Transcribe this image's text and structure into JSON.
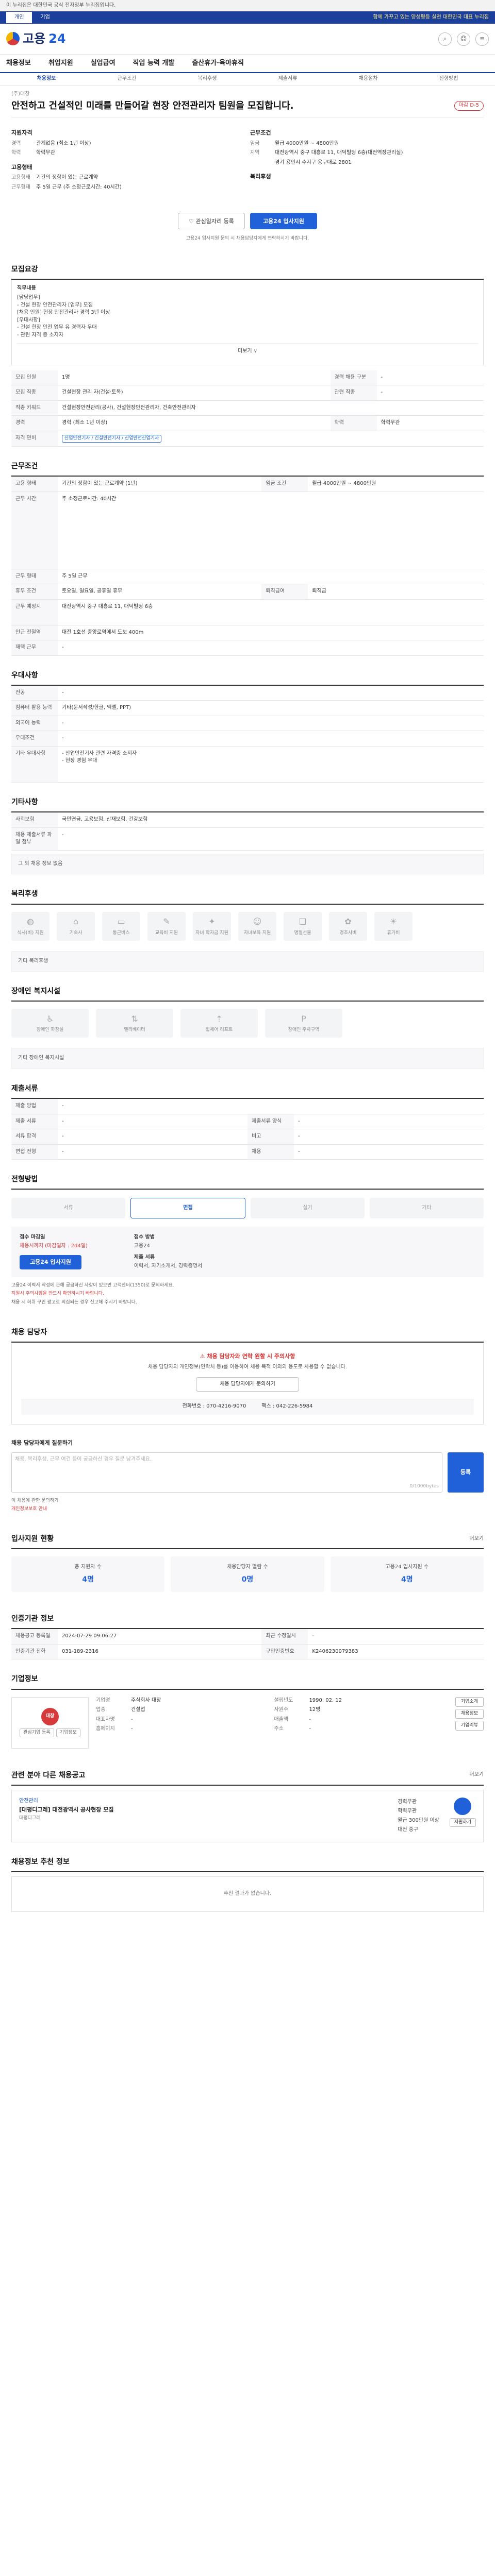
{
  "gov_strip": "이 누리집은 대한민국 공식 전자정부 누리집입니다.",
  "topbar": {
    "tabs": [
      "개인",
      "기업"
    ],
    "right_text": "함께 가꾸고 있는 양성평등 실천 대한민국 대표 누리집"
  },
  "logo": {
    "name": "고용",
    "num": "24"
  },
  "gnb": [
    "채용정보",
    "취업지원",
    "실업급여",
    "직업 능력 개발",
    "출산휴가·육아휴직"
  ],
  "subnav": [
    "채용정보",
    "근무조건",
    "복리후생",
    "제출서류",
    "채용절차",
    "전형방법"
  ],
  "job": {
    "company": "(주)대창",
    "title": "안전하고 건설적인 미래를 만들어갈 현장 안전관리자 팀원을 모집합니다.",
    "badge": "마감 D-5",
    "left_head": "지원자격",
    "left": [
      {
        "k": "경력",
        "v": "관계없음 (최소 1년 이상)"
      },
      {
        "k": "학력",
        "v": "학력무관"
      }
    ],
    "right_head": "근무조건",
    "right": [
      {
        "k": "임금",
        "v": "월급 4000만원 ~ 4800만원"
      },
      {
        "k": "지역",
        "v": "대전광역시 중구 대흥로 11, 대덕빌딩 6층(대전역장관리실)"
      },
      {
        "k": "",
        "v": "경기 용인시 수지구 용구대로 2801"
      }
    ],
    "left_head2": "고용형태",
    "left2": [
      {
        "k": "고용형태",
        "v": "기간의 정함이 있는 근로계약"
      },
      {
        "k": "근무형태",
        "v": "주 5일 근무 (주 소정근로시간: 40시간)"
      }
    ],
    "right_head2": "복리후생",
    "right2": []
  },
  "buttons": {
    "scrap": "관심일자리 등록",
    "apply": "고용24 입사지원"
  },
  "notice": "고용24 입사지원 문의 시 채용담당자에게 연락하시기 바랍니다.",
  "recruit": {
    "title": "모집요강",
    "desc_head": "직무내용",
    "desc": [
      "[담당업무]",
      "- 건설 현장 안전관리자 [업무] 모집",
      "[채용 인원] 현장 안전관리자 경력 3년 이상",
      "[우대사항]",
      "- 건설 현장 안전 업무 유 경력자 우대",
      "- 관련 자격 증 소지자"
    ],
    "expand": "더보기 ∨",
    "rows": [
      {
        "k": "모집 인원",
        "v": "1명",
        "k2": "경력 채용 구분",
        "v2": "-"
      },
      {
        "k": "모집 직종",
        "v": "건설현장 관리 자(건설·토목)",
        "k2": "관련 직종",
        "v2": "-"
      },
      {
        "k": "직종 키워드",
        "v": "건설현장안전관리(공사), 건설현장안전관리자, 건축안전관리자",
        "k2": "",
        "v2": ""
      },
      {
        "k": "경력",
        "v": "경력 (최소 1년 이상)",
        "k2": "학력",
        "v2": "학력무관"
      },
      {
        "k": "자격 면허",
        "v": "산업안전기사 / 건설안전기사 / 산업안전산업기사",
        "k2": "",
        "v2": ""
      }
    ]
  },
  "conditions": {
    "title": "근무조건",
    "rows": [
      {
        "k": "고용 형태",
        "v": "기간의 정함이 있는 근로계약 (1년)",
        "k2": "임금 조건",
        "v2": "월급 4000만원 ~ 4800만원"
      },
      {
        "k": "근무 시간",
        "v": "주 소정근로시간: 40시간",
        "k2": "",
        "v2": ""
      },
      {
        "k": "근무 형태",
        "v": "주 5일 근무",
        "k2": "",
        "v2": ""
      },
      {
        "k": "휴무 조건",
        "v": "토요일, 일요일, 공휴일 휴무",
        "k2": "퇴직급여",
        "v2": "퇴직금"
      },
      {
        "k": "근무 예정지",
        "v": "대전광역시 중구 대흥로 11, 대덕빌딩 6층",
        "k2": "",
        "v2": ""
      },
      {
        "k": "인근 전철역",
        "v": "대전 1호선 중앙로역에서 도보 400m",
        "k2": "",
        "v2": ""
      },
      {
        "k": "재택 근무",
        "v": "-",
        "k2": "",
        "v2": ""
      }
    ]
  },
  "preferences": {
    "title": "우대사항",
    "rows": [
      {
        "k": "전공",
        "v": "-"
      },
      {
        "k": "컴퓨터 활용 능력",
        "v": "기타(문서작성/한글, 엑셀, PPT)"
      },
      {
        "k": "외국어 능력",
        "v": "-"
      },
      {
        "k": "우대조건",
        "v": "-"
      },
      {
        "k": "기타 우대사항",
        "v": "- 산업안전기사 관련 자격증 소지자\n- 현장 경험 우대"
      }
    ]
  },
  "other": {
    "title": "기타사항",
    "rows": [
      {
        "k": "사회보험",
        "v": "국민연금, 고용보험, 산재보험, 건강보험"
      },
      {
        "k": "채용 제출서류 파일 첨부",
        "v": "-"
      }
    ],
    "note": "그 외 채용 정보 없음"
  },
  "welfare": {
    "title": "복리후생",
    "items": [
      "식사(비) 지원",
      "기숙사",
      "통근버스",
      "교육비 지원",
      "자녀 학자금 지원",
      "자녀보육 지원",
      "명절선물",
      "경조사비",
      "휴가비"
    ],
    "note": "기타 복리후생"
  },
  "disability": {
    "title": "장애인 복지시설",
    "items": [
      "장애인 화장실",
      "엘리베이터",
      "휠체어 리프트",
      "장애인 주차구역"
    ],
    "note": "기타 장애인 복지시설"
  },
  "docs": {
    "title": "제출서류",
    "rows": [
      {
        "k": "제출 방법",
        "v": "-",
        "k2": "",
        "v2": ""
      },
      {
        "k": "제출 서류",
        "v": "-",
        "k2": "제출서류 양식",
        "v2": "-"
      },
      {
        "k": "서류 합격",
        "v": "-",
        "k2": "비고",
        "v2": "-"
      },
      {
        "k": "면접 전형",
        "v": "-",
        "k2": "채용",
        "v2": "-"
      }
    ]
  },
  "process": {
    "title": "전형방법",
    "steps": [
      "서류",
      "면접",
      "실기",
      "기타"
    ],
    "active": 1
  },
  "apply": {
    "head1": "접수 마감일",
    "val1": "채용시까지 (마감일자 : 2d4일)",
    "head2": "접수 방법",
    "val2": "고용24",
    "head3": "제출 서류",
    "val3": "이력서, 자기소개서, 경력증명서",
    "btn": "고용24 입사지원"
  },
  "notes": [
    "고용24 이력서 작성에 관해 궁금하신 사항이 있으면 고객센터(1350)로 문의하세요.",
    "지원시 주의사항을 반드시 확인하시기 바랍니다.",
    "채용 시 허위 구인 광고로 의심되는 경우 신고해 주시기 바랍니다."
  ],
  "manager": {
    "title": "채용 담당자",
    "headline": "채용 담당자와 연락 원할 시 주의사항",
    "text": "채용 담당자의 개인정보(연락처 등)를 이용하여 채용 목적 이외의 용도로 사용할 수 없습니다.",
    "btn": "채용 담당자에게 문의하기",
    "contact_phone": "전화번호 : 070-4216-9070",
    "contact_fax": "팩스 : 042-226-5984"
  },
  "inquiry": {
    "title": "채용 담당자에게 질문하기",
    "placeholder": "채용, 복리후생, 근무 여건 등이 궁금하신 경우 질문 남겨주세요.",
    "count": "0/1000bytes",
    "send": "등록",
    "notes": [
      "이 채용에 관한 문의하기",
      "개인정보보호 안내"
    ]
  },
  "applicants": {
    "title": "입사지원 현황",
    "more": "더보기",
    "stats": [
      {
        "label": "총 지원자 수",
        "num": "4명"
      },
      {
        "label": "채용담당자 열람 수",
        "num": "0명"
      },
      {
        "label": "고용24 입사지원 수",
        "num": "4명"
      }
    ]
  },
  "agency": {
    "title": "인증기관 정보",
    "rows": [
      {
        "k": "채용공고 등록일",
        "v": "2024-07-29 09:06:27",
        "k2": "최근 수정일시",
        "v2": "-"
      },
      {
        "k": "인증기관 전화",
        "v": "031-189-2316",
        "k2": "구인인증번호",
        "v2": "K2406230079383"
      }
    ]
  },
  "company": {
    "title": "기업정보",
    "logo_text": "대창",
    "btn1": "관심기업 등록",
    "btn2": "기업정보",
    "info": [
      {
        "k": "기업명",
        "v": "주식회사 대창"
      },
      {
        "k": "설립년도",
        "v": "1990. 02. 12"
      },
      {
        "k": "업종",
        "v": "건설업"
      },
      {
        "k": "사원수",
        "v": "12명"
      },
      {
        "k": "대표자명",
        "v": "-"
      },
      {
        "k": "매출액",
        "v": "-"
      },
      {
        "k": "홈페이지",
        "v": "-"
      },
      {
        "k": "주소",
        "v": "-"
      }
    ],
    "actions": [
      "기업소개",
      "채용정보",
      "기업리뷰"
    ]
  },
  "related": {
    "title": "관련 분야 다른 채용공고",
    "more": "더보기",
    "cat": "안전관리",
    "job_title": "[대평디그레] 대전광역시 공사현장 모집",
    "meta": "대평디그레",
    "mid": [
      "경력무관",
      "학력무관",
      "월급 300만원 이상",
      "대전 중구"
    ],
    "btn": "지원하기"
  },
  "community": {
    "title": "채용정보 추천 정보",
    "empty": "추천 결과가 없습니다."
  }
}
